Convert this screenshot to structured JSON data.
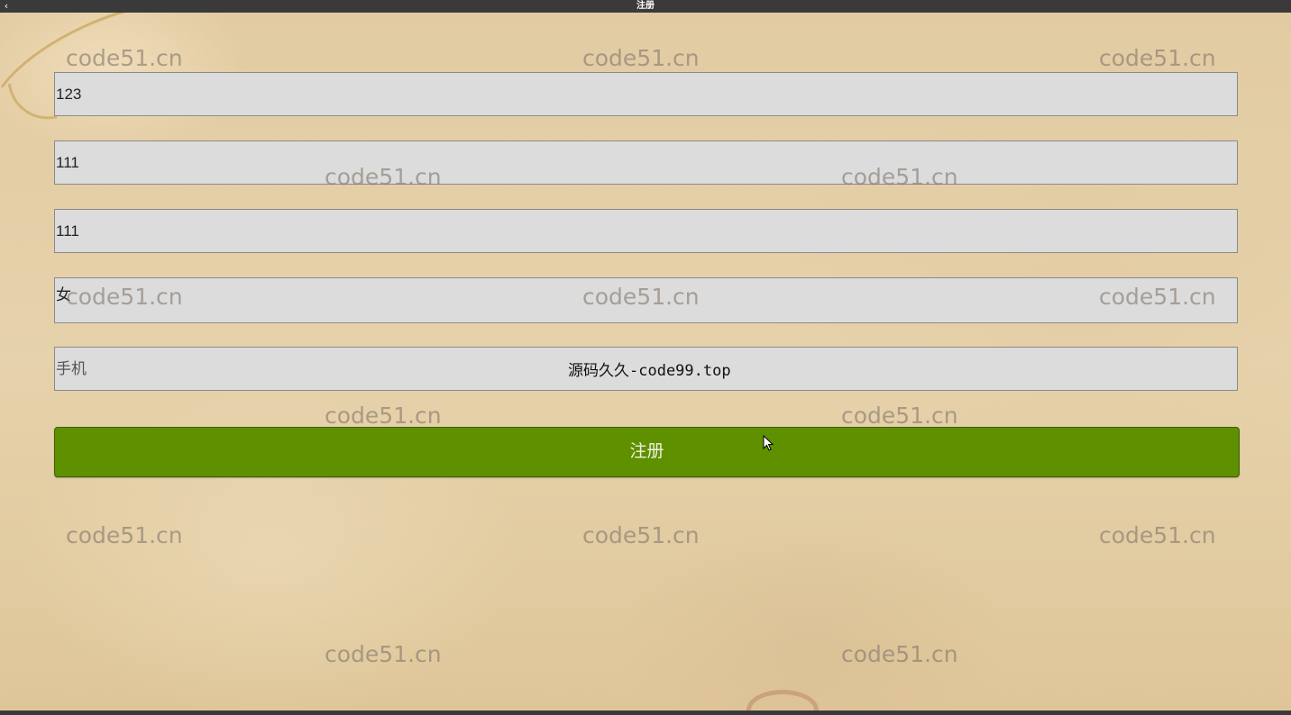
{
  "titlebar": {
    "title": "注册",
    "back_icon": "chevron-left-icon"
  },
  "form": {
    "username_value": "123",
    "password_value": "111",
    "confirm_password_value": "111",
    "gender_value": "女",
    "phone_placeholder": "手机",
    "register_label": "注册"
  },
  "overlay": {
    "source_text": "源码久久-code99.top"
  },
  "watermark": {
    "text": "code51.cn"
  },
  "colors": {
    "button": "#5e9000",
    "field_bg": "#dcdcdc",
    "background": "#e3cda4",
    "titlebar": "#3a3a3a"
  }
}
